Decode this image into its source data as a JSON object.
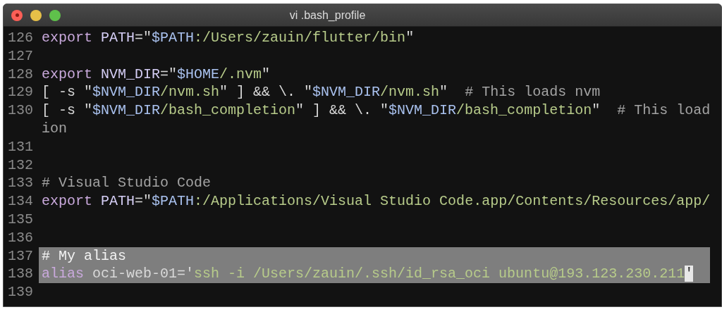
{
  "window": {
    "title": "vi .bash_profile"
  },
  "lines": [
    {
      "number": "126",
      "selected": false,
      "segments": [
        {
          "kind": "keyword",
          "text": "export "
        },
        {
          "kind": "name",
          "text": "PATH"
        },
        {
          "kind": "plain",
          "text": "=\""
        },
        {
          "kind": "variable",
          "text": "$PATH"
        },
        {
          "kind": "string",
          "text": ":/Users/zauin/flutter/bin"
        },
        {
          "kind": "plain",
          "text": "\""
        }
      ]
    },
    {
      "number": "127",
      "selected": false
    },
    {
      "number": "128",
      "selected": false,
      "segments": [
        {
          "kind": "keyword",
          "text": "export "
        },
        {
          "kind": "name",
          "text": "NVM_DIR"
        },
        {
          "kind": "plain",
          "text": "=\""
        },
        {
          "kind": "variable",
          "text": "$HOME"
        },
        {
          "kind": "string",
          "text": "/.nvm"
        },
        {
          "kind": "plain",
          "text": "\""
        }
      ]
    },
    {
      "number": "129",
      "selected": false,
      "segments": [
        {
          "kind": "plain",
          "text": "[ -s \""
        },
        {
          "kind": "variable",
          "text": "$NVM_DIR"
        },
        {
          "kind": "string",
          "text": "/nvm.sh"
        },
        {
          "kind": "plain",
          "text": "\" ] && \\. \""
        },
        {
          "kind": "variable",
          "text": "$NVM_DIR"
        },
        {
          "kind": "string",
          "text": "/nvm.sh"
        },
        {
          "kind": "plain",
          "text": "\"  "
        },
        {
          "kind": "comment",
          "text": "# This loads nvm"
        }
      ]
    },
    {
      "number": "130",
      "selected": false,
      "segments": [
        {
          "kind": "plain",
          "text": "[ -s \""
        },
        {
          "kind": "variable",
          "text": "$NVM_DIR"
        },
        {
          "kind": "string",
          "text": "/bash_completion"
        },
        {
          "kind": "plain",
          "text": "\" ] && \\. \""
        },
        {
          "kind": "variable",
          "text": "$NVM_DIR"
        },
        {
          "kind": "string",
          "text": "/bash_completion"
        },
        {
          "kind": "plain",
          "text": "\"  "
        },
        {
          "kind": "comment",
          "text": "# This load"
        }
      ],
      "wrap": [
        {
          "kind": "comment",
          "text": "ion"
        }
      ]
    },
    {
      "number": "131",
      "selected": false
    },
    {
      "number": "132",
      "selected": false
    },
    {
      "number": "133",
      "selected": false,
      "segments": [
        {
          "kind": "comment",
          "text": "# Visual Studio Code"
        }
      ]
    },
    {
      "number": "134",
      "selected": false,
      "segments": [
        {
          "kind": "keyword",
          "text": "export "
        },
        {
          "kind": "name",
          "text": "PATH"
        },
        {
          "kind": "plain",
          "text": "=\""
        },
        {
          "kind": "variable",
          "text": "$PATH"
        },
        {
          "kind": "string",
          "text": ":/Applications/Visual Studio Code.app/Contents/Resources/app/"
        }
      ]
    },
    {
      "number": "135",
      "selected": false
    },
    {
      "number": "136",
      "selected": false
    },
    {
      "number": "137",
      "selected": true,
      "segments": [
        {
          "kind": "comment",
          "text": "# My alias"
        }
      ]
    },
    {
      "number": "138",
      "selected": true,
      "segments": [
        {
          "kind": "keyword",
          "text": "alias "
        },
        {
          "kind": "plain",
          "text": "oci-web-01='"
        },
        {
          "kind": "string",
          "text": "ssh -i /Users/zauin/.ssh/id_rsa_oci ubuntu@193.123.230.211"
        },
        {
          "kind": "cursor",
          "text": "'"
        }
      ]
    },
    {
      "number": "139",
      "selected": false
    }
  ]
}
